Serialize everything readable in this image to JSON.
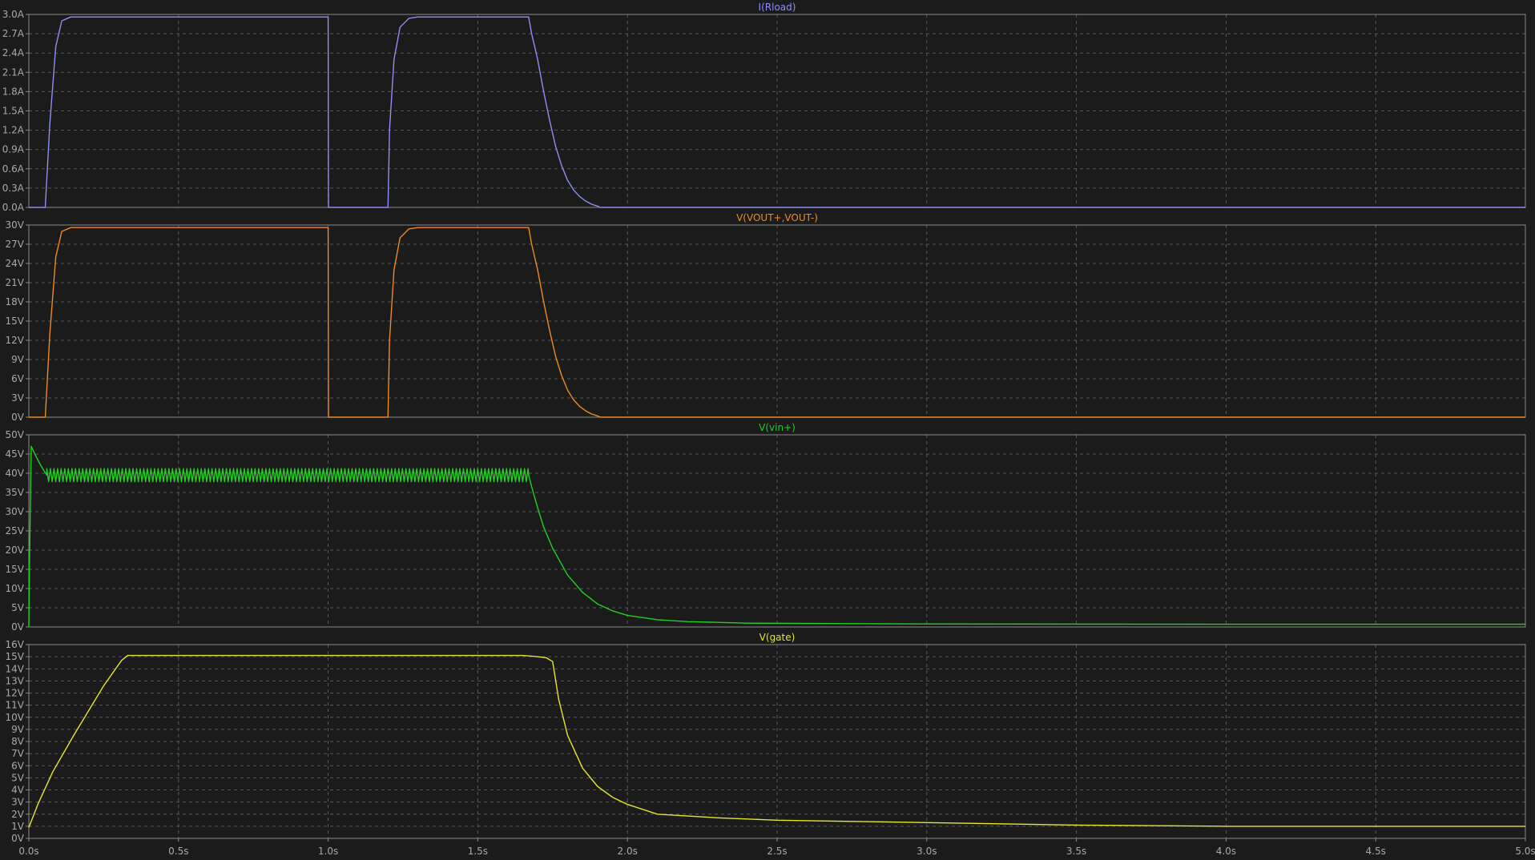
{
  "app": {
    "name": "LTspice waveform viewer"
  },
  "chart_data": [
    {
      "type": "line",
      "title": "I(Rload)",
      "color": "#8e8ef6",
      "xlim": [
        0,
        5
      ],
      "ylim": [
        0,
        3
      ],
      "y_ticks": [
        "0.0A",
        "0.3A",
        "0.6A",
        "0.9A",
        "1.2A",
        "1.5A",
        "1.8A",
        "2.1A",
        "2.4A",
        "2.7A",
        "3.0A"
      ],
      "x_ticks": [],
      "series": [
        {
          "x": [
            0,
            0.055,
            0.07,
            0.09,
            0.11,
            0.14,
            1.0,
            1.001,
            1.2,
            1.205,
            1.22,
            1.24,
            1.27,
            1.3,
            1.67,
            1.68,
            1.7,
            1.72,
            1.74,
            1.76,
            1.78,
            1.8,
            1.82,
            1.84,
            1.86,
            1.88,
            1.9,
            1.91,
            5.0
          ],
          "y": [
            0,
            0,
            1.3,
            2.5,
            2.9,
            2.96,
            2.96,
            0,
            0,
            1.2,
            2.3,
            2.8,
            2.94,
            2.96,
            2.96,
            2.7,
            2.3,
            1.8,
            1.35,
            0.95,
            0.65,
            0.42,
            0.27,
            0.17,
            0.1,
            0.05,
            0.02,
            0,
            0
          ]
        }
      ]
    },
    {
      "type": "line",
      "title": "V(VOUT+,VOUT-)",
      "color": "#f08a24",
      "xlim": [
        0,
        5
      ],
      "ylim": [
        0,
        30
      ],
      "y_ticks": [
        "0V",
        "3V",
        "6V",
        "9V",
        "12V",
        "15V",
        "18V",
        "21V",
        "24V",
        "27V",
        "30V"
      ],
      "x_ticks": [],
      "series": [
        {
          "x": [
            0,
            0.055,
            0.07,
            0.09,
            0.11,
            0.14,
            1.0,
            1.001,
            1.2,
            1.205,
            1.22,
            1.24,
            1.27,
            1.3,
            1.67,
            1.68,
            1.7,
            1.72,
            1.74,
            1.76,
            1.78,
            1.8,
            1.82,
            1.84,
            1.86,
            1.88,
            1.9,
            1.91,
            5.0
          ],
          "y": [
            0,
            0,
            13,
            25,
            29,
            29.6,
            29.6,
            0,
            0,
            12,
            23,
            28,
            29.4,
            29.6,
            29.6,
            27,
            23,
            18,
            13.5,
            9.5,
            6.5,
            4.2,
            2.7,
            1.7,
            1.0,
            0.5,
            0.2,
            0,
            0
          ]
        }
      ]
    },
    {
      "type": "line",
      "title": "V(vin+)",
      "color": "#22d022",
      "xlim": [
        0,
        5
      ],
      "ylim": [
        0,
        50
      ],
      "y_ticks": [
        "0V",
        "5V",
        "10V",
        "15V",
        "20V",
        "25V",
        "30V",
        "35V",
        "40V",
        "45V",
        "50V"
      ],
      "x_ticks": [],
      "ripple": {
        "start": 0.06,
        "end": 1.67,
        "center": 39.5,
        "amplitude": 1.7,
        "period": 0.012
      },
      "series": [
        {
          "x": [
            0,
            0.002,
            0.008,
            0.02,
            0.04,
            0.06,
            1.67,
            1.68,
            1.7,
            1.72,
            1.75,
            1.8,
            1.85,
            1.9,
            1.95,
            2.0,
            2.1,
            2.2,
            2.4,
            3.0,
            4.0,
            5.0
          ],
          "y": [
            0,
            15,
            47,
            45,
            42,
            39.5,
            39.5,
            36.5,
            31,
            26,
            20.5,
            13.5,
            9.0,
            6.0,
            4.2,
            3.0,
            1.9,
            1.4,
            1.0,
            0.8,
            0.7,
            0.7
          ]
        }
      ]
    },
    {
      "type": "line",
      "title": "V(gate)",
      "color": "#e6e62a",
      "xlim": [
        0,
        5
      ],
      "ylim": [
        0,
        16
      ],
      "y_ticks": [
        "0V",
        "1V",
        "2V",
        "3V",
        "4V",
        "5V",
        "6V",
        "7V",
        "8V",
        "9V",
        "10V",
        "11V",
        "12V",
        "13V",
        "14V",
        "15V",
        "16V"
      ],
      "x_ticks": [
        "0.0s",
        "0.5s",
        "1.0s",
        "1.5s",
        "2.0s",
        "2.5s",
        "3.0s",
        "3.5s",
        "4.0s",
        "4.5s",
        "5.0s"
      ],
      "series": [
        {
          "x": [
            0,
            0.03,
            0.08,
            0.15,
            0.25,
            0.31,
            0.33,
            1.4,
            1.65,
            1.7,
            1.73,
            1.75,
            1.77,
            1.8,
            1.85,
            1.9,
            1.95,
            2.0,
            2.1,
            2.3,
            2.5,
            3.0,
            3.5,
            4.0,
            4.5,
            5.0
          ],
          "y": [
            0.9,
            2.8,
            5.5,
            8.5,
            12.6,
            14.7,
            15.1,
            15.1,
            15.1,
            15.0,
            14.9,
            14.6,
            11.5,
            8.5,
            5.8,
            4.3,
            3.4,
            2.8,
            2.0,
            1.7,
            1.5,
            1.3,
            1.1,
            1.0,
            1.0,
            1.0
          ]
        }
      ]
    }
  ]
}
